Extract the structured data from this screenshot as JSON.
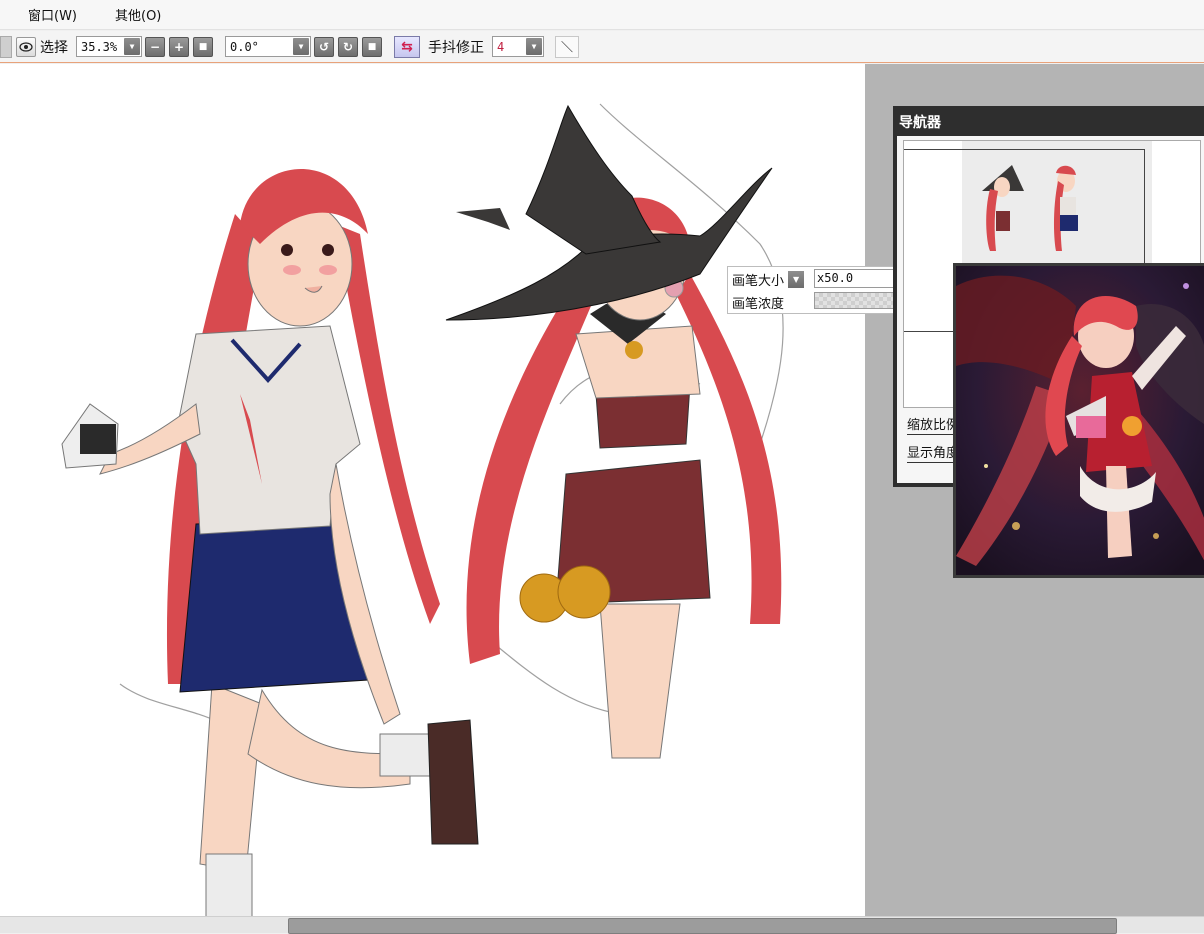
{
  "menu": {
    "items": [
      "窗口(W)",
      "其他(O)"
    ]
  },
  "toolbar": {
    "select_label": "选择",
    "zoom_value": "35.3%",
    "rotation_value": "0.0°",
    "stabilizer_label": "手抖修正",
    "stabilizer_value": "4",
    "minus_symbol": "−",
    "plus_symbol": "+",
    "square_symbol": "■",
    "rotate_ccw_symbol": "↺",
    "rotate_cw_symbol": "↻",
    "swap_symbol": "⇆",
    "line_symbol": "＼"
  },
  "brush_popup": {
    "size_label": "画笔大小",
    "size_value": "x50.0",
    "density_label": "画笔浓度"
  },
  "navigator": {
    "title": "导航器",
    "zoom_label": "缩放比例",
    "angle_label": "显示角度"
  },
  "colors": {
    "hair": "#d84a4f",
    "skirt": "#1e2a6e",
    "hat": "#3a3837",
    "dress": "#7b2f32",
    "pumpkin": "#d79a22",
    "skin": "#f8d6c2",
    "accent_line": "#e8a27a"
  }
}
